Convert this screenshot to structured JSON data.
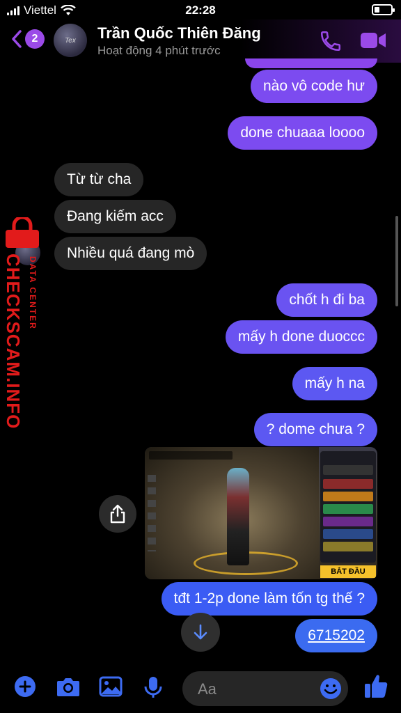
{
  "status_bar": {
    "carrier": "Viettel",
    "time": "22:28"
  },
  "header": {
    "unread_count": "2",
    "contact_name": "Trần Quốc Thiên Đăng",
    "activity": "Hoạt động 4 phút trước",
    "avatar_text": "Tex"
  },
  "messages": [
    {
      "side": "out",
      "text": "nào vô code hư"
    },
    {
      "side": "out",
      "text": "done chuaaa loooo"
    },
    {
      "side": "in",
      "text": "Từ từ cha"
    },
    {
      "side": "in",
      "text": "Đang kiếm acc"
    },
    {
      "side": "in",
      "text": "Nhiều quá đang mò"
    },
    {
      "side": "out",
      "text": "chốt h đi ba"
    },
    {
      "side": "out",
      "text": "mấy h done duoccc"
    },
    {
      "side": "out",
      "text": "mấy h na"
    },
    {
      "side": "out",
      "text": "? dome chưa ?"
    },
    {
      "side": "out",
      "text": "tđt 1-2p done làm tốn tg thế ?"
    },
    {
      "side": "out",
      "text": "6715202"
    }
  ],
  "image_message": {
    "button_text": "BẮT ĐẦU"
  },
  "composer": {
    "placeholder": "Aa"
  },
  "watermark": {
    "main": "CHECKSCAM.INFO",
    "sub": "DATA CENTER"
  },
  "colors": {
    "accent": "#7c4bf0",
    "incoming": "#262626",
    "watermark": "#e21b1b"
  }
}
